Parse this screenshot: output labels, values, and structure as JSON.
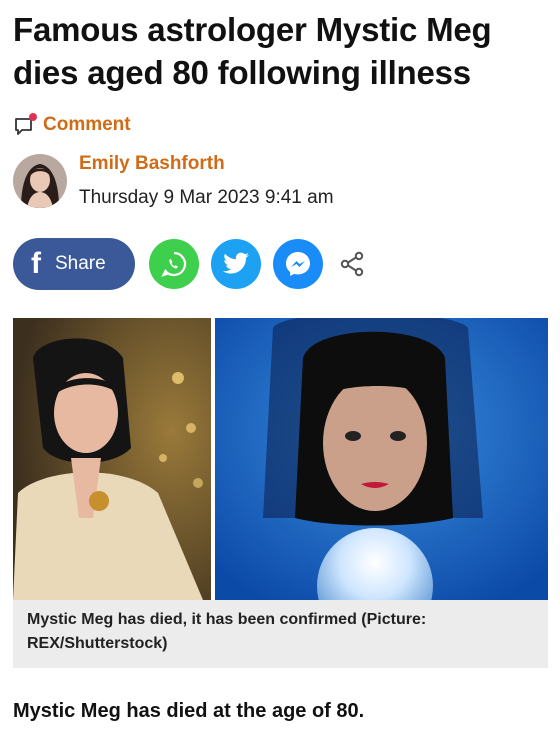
{
  "article": {
    "headline": "Famous astrologer Mystic Meg dies aged 80 following illness",
    "comment_label": "Comment",
    "author": "Emily Bashforth",
    "date": "Thursday 9 Mar 2023 9:41 am",
    "caption": "Mystic Meg has died, it has been confirmed (Picture: REX/Shutterstock)",
    "first_paragraph": "Mystic Meg has died at the age of 80."
  },
  "share": {
    "facebook_label": "Share",
    "facebook_glyph": "f",
    "buttons": [
      "whatsapp-icon",
      "twitter-icon",
      "messenger-icon",
      "share-icon"
    ]
  },
  "colors": {
    "accent": "#d06c18",
    "facebook": "#3b5998",
    "whatsapp": "#3ecf4c",
    "twitter": "#1da1f2",
    "messenger": "#1a8cf7",
    "caption_bg": "#ececec"
  }
}
